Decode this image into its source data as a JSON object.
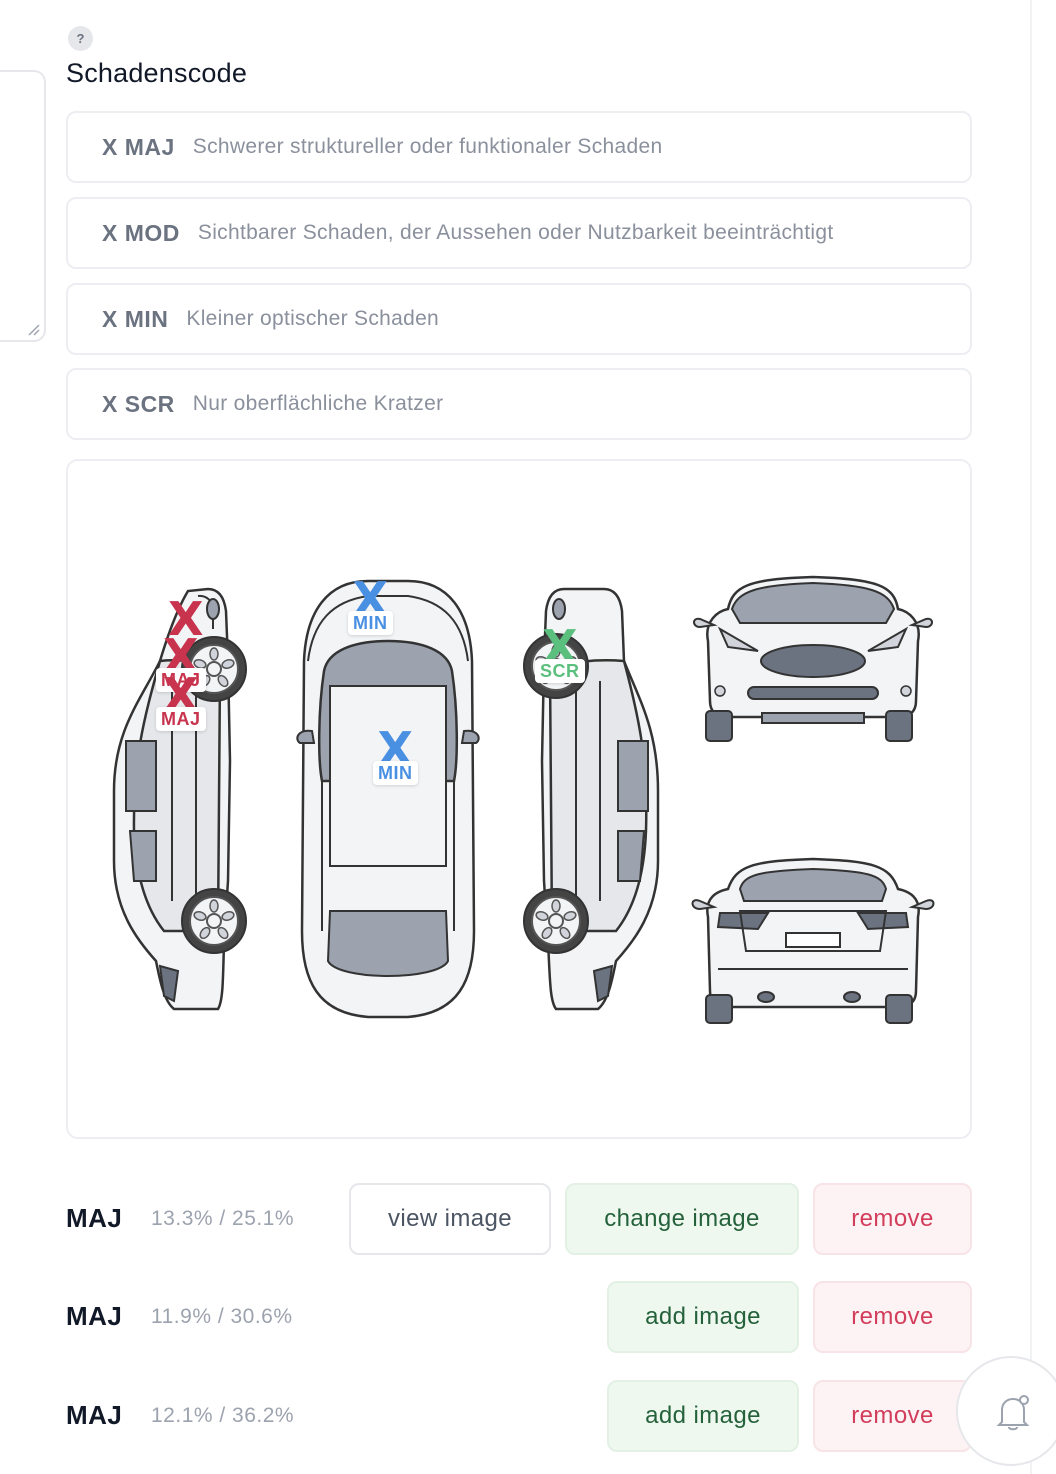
{
  "help": {
    "label": "?"
  },
  "section": {
    "title": "Schadenscode"
  },
  "codes": [
    {
      "key": "X MAJ",
      "desc": "Schwerer struktureller oder funktionaler Schaden"
    },
    {
      "key": "X MOD",
      "desc": "Sichtbarer Schaden, der Aussehen oder Nutzbarkeit beeinträchtigt"
    },
    {
      "key": "X MIN",
      "desc": "Kleiner optischer Schaden"
    },
    {
      "key": "X SCR",
      "desc": "Nur oberflächliche Kratzer"
    }
  ],
  "colors": {
    "maj": "#c8344e",
    "min": "#4a90e2",
    "scr": "#5bbf7e"
  },
  "markers": [
    {
      "x": "X",
      "label": "MAJ",
      "color": "#c8344e"
    },
    {
      "x": "X",
      "label": "MAJ",
      "color": "#c8344e"
    },
    {
      "x": "X",
      "label": "MAJ",
      "color": "#c8344e"
    },
    {
      "x": "X",
      "label": "MIN",
      "color": "#4a90e2"
    },
    {
      "x": "X",
      "label": "MIN",
      "color": "#4a90e2"
    },
    {
      "x": "X",
      "label": "SCR",
      "color": "#5bbf7e"
    }
  ],
  "damages": [
    {
      "code": "MAJ",
      "pct": "13.3% / 25.1%",
      "view": "view image",
      "image": "change image",
      "remove": "remove"
    },
    {
      "code": "MAJ",
      "pct": "11.9% / 30.6%",
      "image": "add image",
      "remove": "remove"
    },
    {
      "code": "MAJ",
      "pct": "12.1% / 36.2%",
      "image": "add image",
      "remove": "remove"
    }
  ],
  "icons": {
    "notification": "bell-icon",
    "help": "question-icon",
    "resize": "resize-grip-icon"
  }
}
